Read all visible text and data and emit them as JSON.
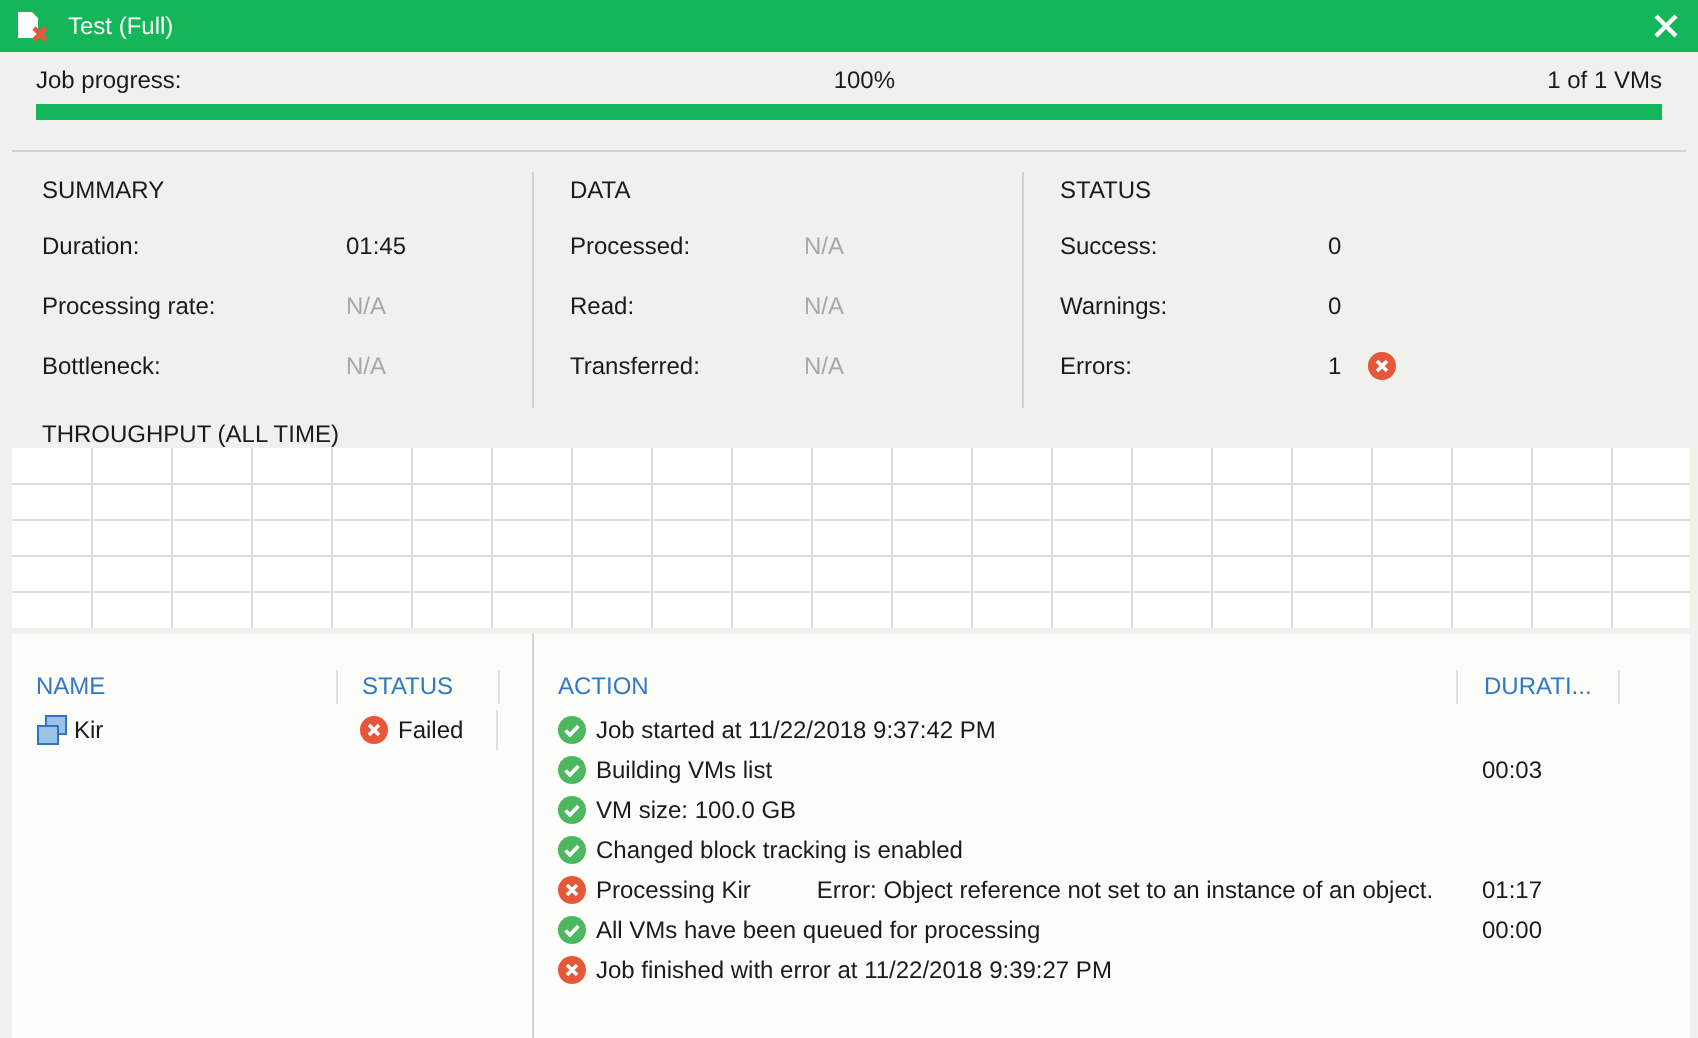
{
  "window": {
    "title": "Test (Full)"
  },
  "progress": {
    "label": "Job progress:",
    "percent": "100%",
    "count": "1 of 1 VMs",
    "level": 1
  },
  "stats": [
    {
      "title": "SUMMARY",
      "items": [
        {
          "label": "Duration:",
          "value": "01:45",
          "muted": false,
          "kind": "plain"
        },
        {
          "label": "Processing rate:",
          "value": "N/A",
          "muted": true,
          "kind": "plain"
        },
        {
          "label": "Bottleneck:",
          "value": "N/A",
          "muted": true,
          "kind": "plain"
        }
      ]
    },
    {
      "title": "DATA",
      "items": [
        {
          "label": "Processed:",
          "value": "N/A",
          "muted": true,
          "kind": "plain"
        },
        {
          "label": "Read:",
          "value": "N/A",
          "muted": true,
          "kind": "plain"
        },
        {
          "label": "Transferred:",
          "value": "N/A",
          "muted": true,
          "kind": "plain"
        }
      ]
    },
    {
      "title": "STATUS",
      "items": [
        {
          "label": "Success:",
          "value": "0",
          "muted": false,
          "kind": "plain"
        },
        {
          "label": "Warnings:",
          "value": "0",
          "muted": false,
          "kind": "plain"
        },
        {
          "label": "Errors:",
          "value": "1",
          "muted": false,
          "kind": "error"
        }
      ]
    }
  ],
  "throughput": {
    "title": "THROUGHPUT (ALL TIME)"
  },
  "vms": {
    "columns": [
      "NAME",
      "STATUS"
    ],
    "rows": [
      {
        "name": "Kir",
        "status": "Failed",
        "kind": "error",
        "selected": false
      }
    ]
  },
  "actions": {
    "columns": [
      "ACTION",
      "DURATI..."
    ],
    "rows": [
      {
        "kind": "success",
        "text": "Job started at 11/22/2018 9:37:42 PM"
      },
      {
        "kind": "success",
        "text": "Building VMs list",
        "duration": "00:03"
      },
      {
        "kind": "success",
        "text": "VM size: 100.0 GB"
      },
      {
        "kind": "success",
        "text": "Changed block tracking is enabled"
      },
      {
        "kind": "error",
        "text": "Processing Kir",
        "detail": "Error: Object reference not set to an instance of an object.",
        "duration": "01:17"
      },
      {
        "kind": "success",
        "text": "All VMs have been queued for processing",
        "duration": "00:00"
      },
      {
        "kind": "error",
        "text": "Job finished with error at 11/22/2018 9:39:27 PM"
      }
    ]
  }
}
